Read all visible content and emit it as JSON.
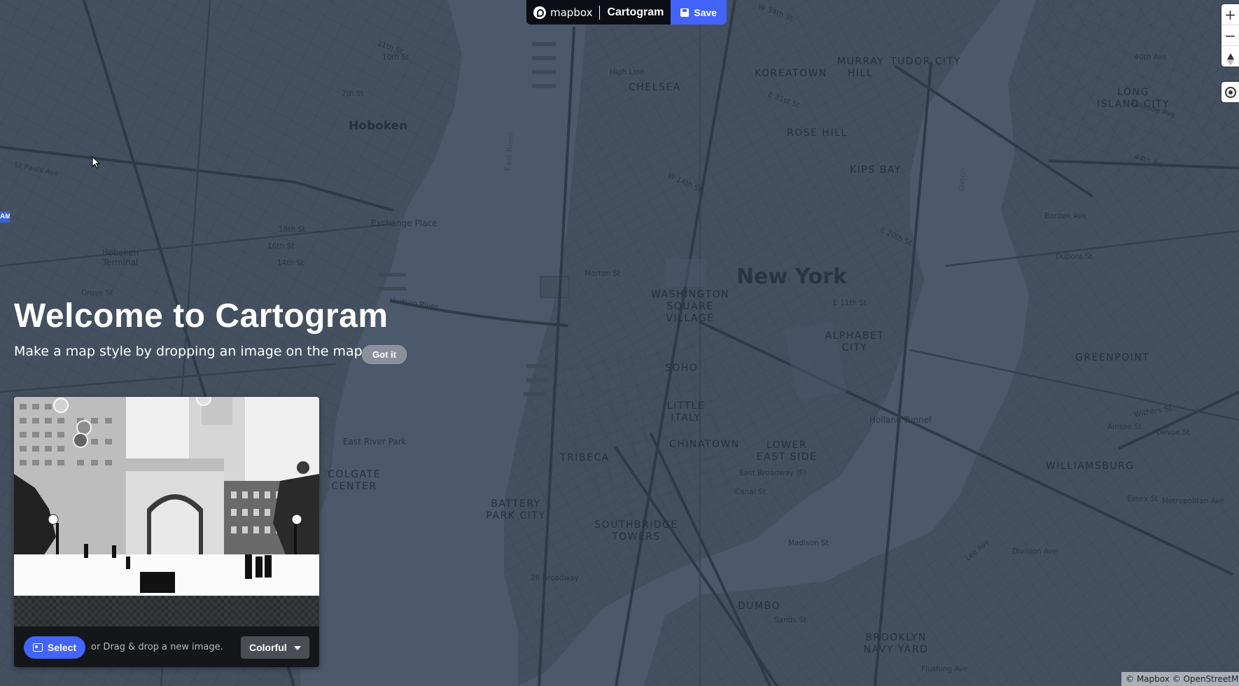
{
  "app": {
    "brand": "mapbox",
    "name": "Cartogram",
    "save_label": "Save",
    "accent_color": "#4264fb"
  },
  "map": {
    "city_label": "New York",
    "neighborhoods": [
      {
        "text": "CHELSEA"
      },
      {
        "text": "KOREATOWN"
      },
      {
        "text": "MURRAY HILL"
      },
      {
        "text": "TUDOR CITY"
      },
      {
        "text": "ROSE HILL"
      },
      {
        "text": "KIPS BAY"
      },
      {
        "text": "WASHINGTON SQUARE VILLAGE"
      },
      {
        "text": "ALPHABET CITY"
      },
      {
        "text": "SOHO"
      },
      {
        "text": "LITTLE ITALY"
      },
      {
        "text": "CHINATOWN"
      },
      {
        "text": "LOWER EAST SIDE"
      },
      {
        "text": "TRIBECA"
      },
      {
        "text": "BATTERY PARK CITY"
      },
      {
        "text": "SOUTHBRIDGE TOWERS"
      },
      {
        "text": "DUMBO"
      },
      {
        "text": "BROOKLYN NAVY YARD"
      },
      {
        "text": "WILLIAMSBURG"
      },
      {
        "text": "GREENPOINT"
      },
      {
        "text": "LONG ISLAND CITY"
      },
      {
        "text": "COLGATE CENTER"
      }
    ],
    "places": [
      {
        "text": "Hoboken"
      }
    ],
    "streets": [
      {
        "text": "W 34th St"
      },
      {
        "text": "W 27th St"
      },
      {
        "text": "W 23rd St"
      },
      {
        "text": "W 19th St"
      },
      {
        "text": "W 14th St"
      },
      {
        "text": "E 31st St"
      },
      {
        "text": "E 23rd St"
      },
      {
        "text": "E 20th St"
      },
      {
        "text": "E 11th St"
      },
      {
        "text": "E 3rd St"
      },
      {
        "text": "Bleecker St"
      },
      {
        "text": "Broadway"
      },
      {
        "text": "Canal St"
      },
      {
        "text": "Madison St"
      },
      {
        "text": "South St"
      },
      {
        "text": "Houston St"
      },
      {
        "text": "1st Ave"
      },
      {
        "text": "2nd Ave"
      },
      {
        "text": "5th Ave"
      },
      {
        "text": "8th Ave"
      },
      {
        "text": "7th Ave"
      },
      {
        "text": "9th Ave"
      },
      {
        "text": "6th Ave"
      },
      {
        "text": "West St"
      },
      {
        "text": "Hudson St"
      },
      {
        "text": "Varick St"
      },
      {
        "text": "Grand St"
      },
      {
        "text": "Delancey St"
      },
      {
        "text": "Essex St"
      },
      {
        "text": "Chrystie St"
      },
      {
        "text": "Kent Ave"
      },
      {
        "text": "Bedford Ave"
      },
      {
        "text": "Driggs Ave"
      },
      {
        "text": "Manhattan Ave"
      },
      {
        "text": "McGuinness Blvd"
      },
      {
        "text": "Greenpoint Ave"
      },
      {
        "text": "India St"
      },
      {
        "text": "Dupont St"
      },
      {
        "text": "Borden Ave"
      },
      {
        "text": "44th Rd"
      },
      {
        "text": "40th Ave"
      },
      {
        "text": "Palisade Ave"
      },
      {
        "text": "Central Ave"
      },
      {
        "text": "Summit Ave"
      },
      {
        "text": "Kennedy Blvd"
      },
      {
        "text": "Jefferson St"
      },
      {
        "text": "Monroe St"
      },
      {
        "text": "Bloomfield St"
      },
      {
        "text": "Clinton St"
      },
      {
        "text": "Newark Ave"
      },
      {
        "text": "18th St"
      },
      {
        "text": "16th St"
      },
      {
        "text": "14th St"
      },
      {
        "text": "12th St"
      },
      {
        "text": "11th St"
      },
      {
        "text": "10th St"
      },
      {
        "text": "7th St"
      },
      {
        "text": "Beach St"
      },
      {
        "text": "Perry St"
      },
      {
        "text": "Sip Ave"
      },
      {
        "text": "Tonnelle Ave"
      },
      {
        "text": "St Pauls Ave"
      },
      {
        "text": "Bergen"
      },
      {
        "text": "Grove St"
      },
      {
        "text": "Morton St"
      },
      {
        "text": "Pearl St"
      },
      {
        "text": "Water St"
      },
      {
        "text": "Front St"
      },
      {
        "text": "York St"
      },
      {
        "text": "Sands St"
      },
      {
        "text": "Flushing Ave"
      },
      {
        "text": "Lee Ave"
      },
      {
        "text": "Division Ave"
      },
      {
        "text": "Metropolitan Ave"
      },
      {
        "text": "Union Ave"
      },
      {
        "text": "Graham Ave"
      },
      {
        "text": "Lorimer St"
      },
      {
        "text": "N 10th St"
      },
      {
        "text": "N 3rd St"
      },
      {
        "text": "S 3rd St"
      },
      {
        "text": "Frost St"
      },
      {
        "text": "Withers St"
      },
      {
        "text": "Ainslie St"
      },
      {
        "text": "Devoe St"
      },
      {
        "text": "Powers St"
      },
      {
        "text": "FDR Dr"
      },
      {
        "text": "Franklin St"
      },
      {
        "text": "Kingsland Ave"
      },
      {
        "text": "Morgan Ave"
      },
      {
        "text": "Humboldt St"
      },
      {
        "text": "Bushwick Ave"
      },
      {
        "text": "Leonard St"
      },
      {
        "text": "Jackson Ave"
      },
      {
        "text": "Thomson Ave"
      },
      {
        "text": "Bleecker St"
      },
      {
        "text": "Prospect St"
      },
      {
        "text": "26 Broadway"
      },
      {
        "text": "East Broadway (F)"
      },
      {
        "text": "High Line"
      },
      {
        "text": "Journal Square Plaza (PATH)"
      },
      {
        "text": "Hoboken Terminal"
      },
      {
        "text": "Exchange Place"
      },
      {
        "text": "East River Park"
      },
      {
        "text": "Holland Tunnel"
      },
      {
        "text": "Hudson River"
      },
      {
        "text": "East River"
      },
      {
        "text": "Oxton"
      }
    ]
  },
  "welcome": {
    "title": "Welcome to Cartogram",
    "subtitle": "Make a map style by dropping an image on the map.",
    "got_it": "Got it"
  },
  "panel": {
    "select_label": "Select",
    "drag_text": "or Drag & drop a new image.",
    "palette_value": "Colorful",
    "swatches": [
      "#d2d2d2",
      "#e0e0e0",
      "#8e8e8e",
      "#646464",
      "#3a3a3a"
    ]
  },
  "controls": {
    "zoom_in": "+",
    "zoom_out": "−"
  },
  "side_badge": "AM",
  "attribution": "© Mapbox © OpenStreetMap"
}
